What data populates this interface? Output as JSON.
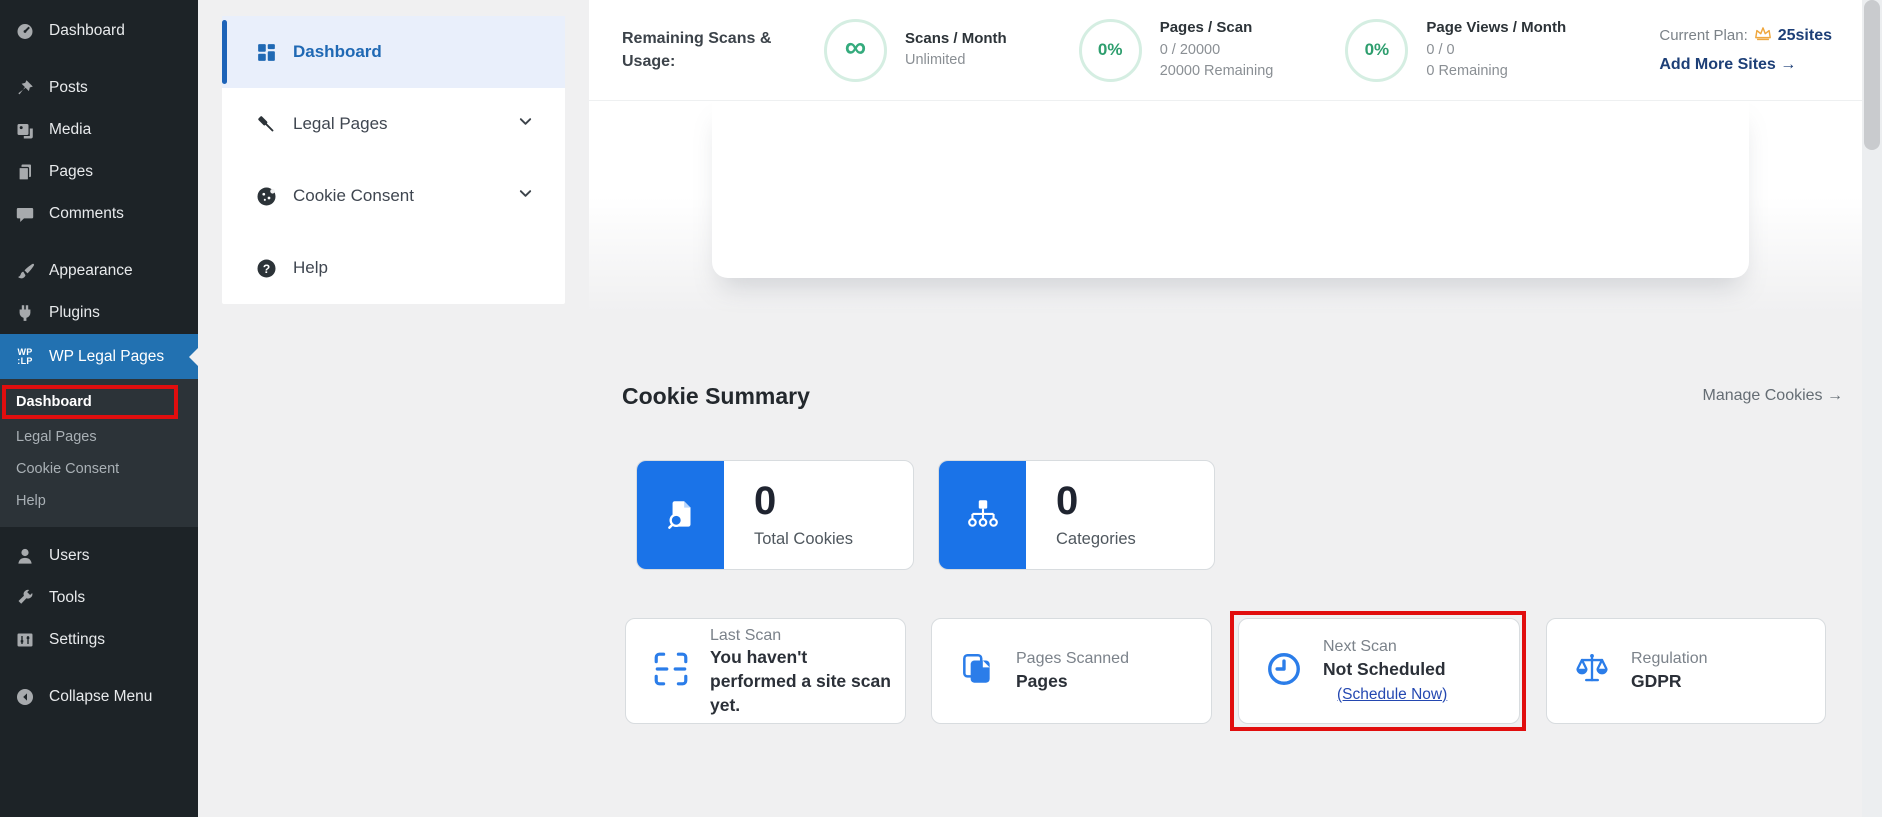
{
  "colors": {
    "accent_blue": "#1a73e8",
    "wp_admin_blue": "#2271b1",
    "success_green": "#2e9e6e",
    "plan_navy": "#1d3f77",
    "highlight_red": "#e10e0e"
  },
  "wp_sidebar": {
    "items": [
      {
        "label": "Dashboard"
      },
      {
        "label": "Posts"
      },
      {
        "label": "Media"
      },
      {
        "label": "Pages"
      },
      {
        "label": "Comments"
      },
      {
        "label": "Appearance"
      },
      {
        "label": "Plugins"
      },
      {
        "label": "WP Legal Pages"
      },
      {
        "label": "Users"
      },
      {
        "label": "Tools"
      },
      {
        "label": "Settings"
      },
      {
        "label": "Collapse Menu"
      }
    ],
    "logo_line1": "WP",
    "logo_line2": ":LP",
    "submenu": [
      {
        "label": "Dashboard"
      },
      {
        "label": "Legal Pages"
      },
      {
        "label": "Cookie Consent"
      },
      {
        "label": "Help"
      }
    ]
  },
  "plugin_sidebar": {
    "items": [
      {
        "label": "Dashboard"
      },
      {
        "label": "Legal Pages"
      },
      {
        "label": "Cookie Consent"
      },
      {
        "label": "Help"
      }
    ]
  },
  "stats_bar": {
    "title": "Remaining Scans & Usage:",
    "scans_month": {
      "symbol": "∞",
      "label": "Scans / Month",
      "value": "Unlimited"
    },
    "pages_scan": {
      "percent": "0%",
      "label": "Pages / Scan",
      "value": "0 / 20000",
      "remaining": "20000 Remaining"
    },
    "page_views": {
      "percent": "0%",
      "label": "Page Views / Month",
      "value": "0 / 0",
      "remaining": "0 Remaining"
    },
    "plan": {
      "label": "Current Plan:",
      "name": "25sites",
      "add_more": "Add More Sites →"
    }
  },
  "main": {
    "section_title": "Cookie Summary",
    "manage_link": "Manage Cookies →",
    "stat_cards": [
      {
        "value": "0",
        "label": "Total Cookies"
      },
      {
        "value": "0",
        "label": "Categories"
      }
    ],
    "info_cards": [
      {
        "label": "Last Scan",
        "value": "You haven't performed a site scan yet."
      },
      {
        "label": "Pages Scanned",
        "value": "Pages"
      },
      {
        "label": "Next Scan",
        "value": "Not Scheduled",
        "link": "(Schedule Now)"
      },
      {
        "label": "Regulation",
        "value": "GDPR"
      }
    ]
  }
}
